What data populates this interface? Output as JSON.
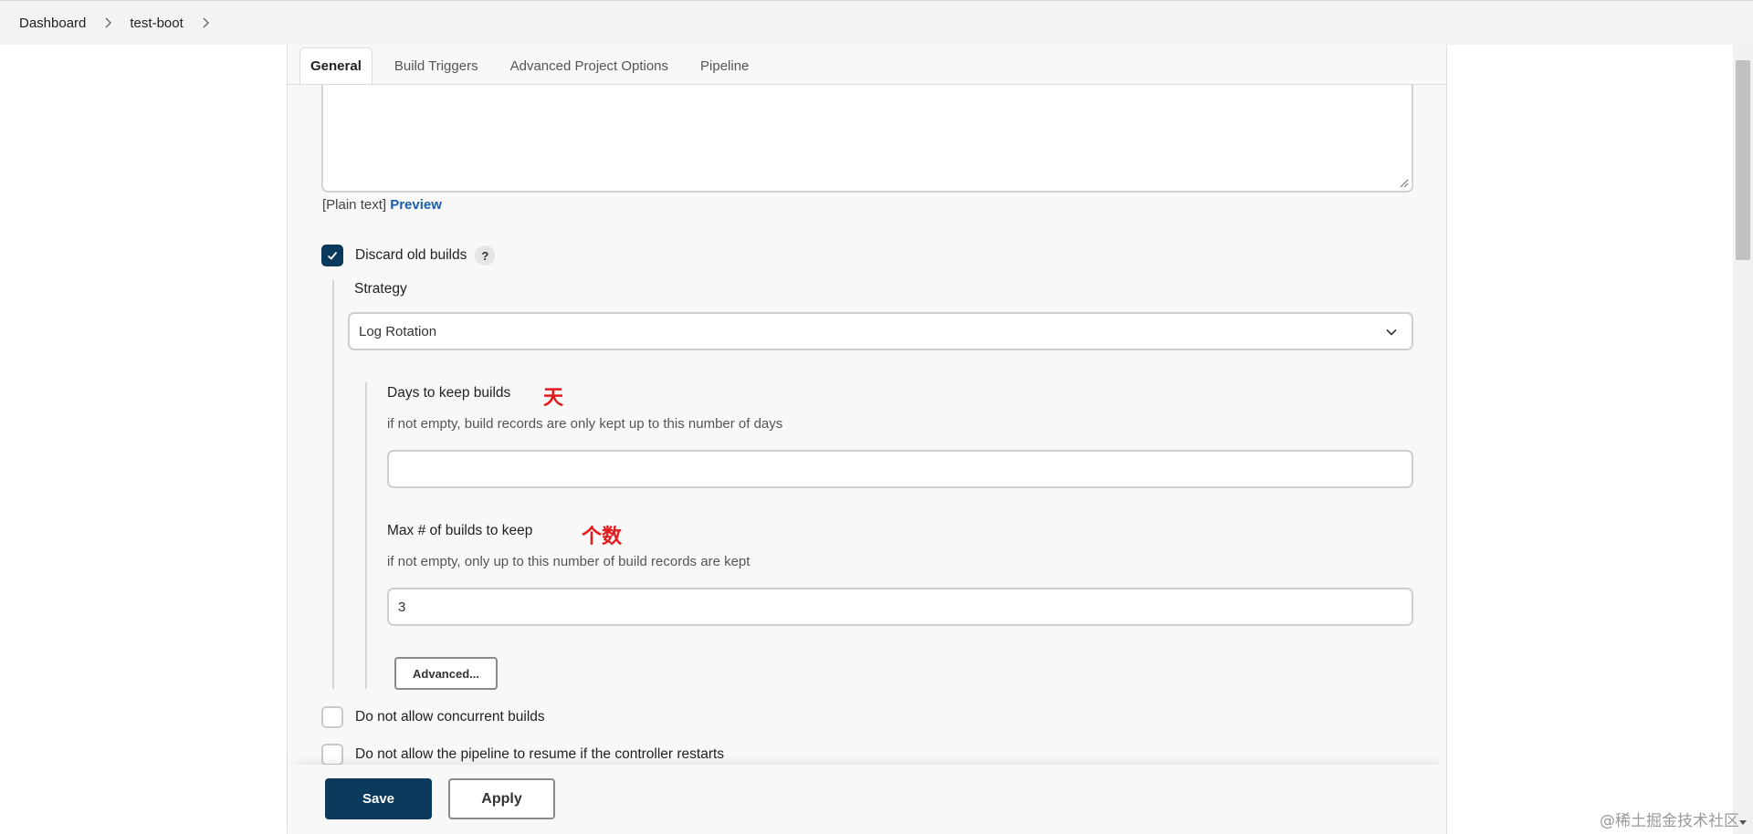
{
  "breadcrumb": {
    "items": [
      "Dashboard",
      "test-boot"
    ]
  },
  "tabs": [
    "General",
    "Build Triggers",
    "Advanced Project Options",
    "Pipeline"
  ],
  "description": {
    "format_text": "[Plain text]",
    "preview_link": "Preview"
  },
  "discard_old_builds": {
    "label": "Discard old builds",
    "checked": true,
    "help": "?",
    "strategy_label": "Strategy",
    "strategy_value": "Log Rotation",
    "days": {
      "label": "Days to keep builds",
      "annotation": "天",
      "help": "if not empty, build records are only kept up to this number of days",
      "value": ""
    },
    "max": {
      "label": "Max # of builds to keep",
      "annotation": "个数",
      "help": "if not empty, only up to this number of build records are kept",
      "value": "3"
    },
    "advanced_button": "Advanced..."
  },
  "options": [
    {
      "label": "Do not allow concurrent builds",
      "checked": false
    },
    {
      "label": "Do not allow the pipeline to resume if the controller restarts",
      "checked": false
    }
  ],
  "actions": {
    "save": "Save",
    "apply": "Apply"
  },
  "watermark": "@稀土掘金技术社区",
  "colors": {
    "primary": "#0b3a5c",
    "link": "#1a5cab",
    "annotation": "#e31a1a"
  }
}
